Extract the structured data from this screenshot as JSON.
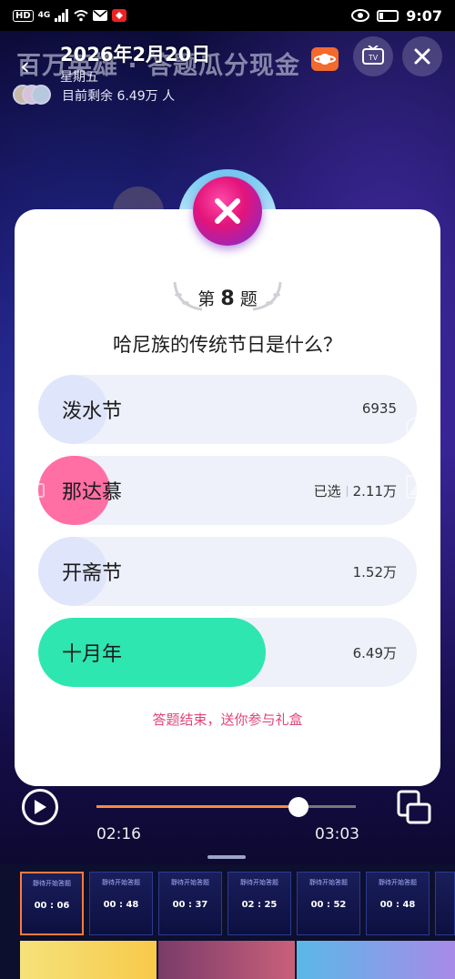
{
  "status_bar": {
    "hd": "HD",
    "signal": "4G",
    "time": "9:07"
  },
  "header": {
    "banner_title": "百万英雄 · 答题瓜分现金",
    "date": "2026年2月20日",
    "weekday": "星期五",
    "remaining": "目前剩余 6.49万 人"
  },
  "quiz": {
    "question_prefix": "第",
    "question_number": "8",
    "question_suffix": "题",
    "question": "哈尼族的传统节日是什么？",
    "options": [
      {
        "label": "泼水节",
        "count": "6935",
        "selected": "",
        "fraction": 0.17,
        "color": "#dfe5fb"
      },
      {
        "label": "那达慕",
        "count": "2.11万",
        "selected": "已选",
        "fraction": 0.19,
        "color": "#ff6fa4"
      },
      {
        "label": "开斋节",
        "count": "1.52万",
        "selected": "",
        "fraction": 0.17,
        "color": "#dfe5fb"
      },
      {
        "label": "十月年",
        "count": "6.49万",
        "selected": "",
        "fraction": 0.6,
        "color": "#2ee6b0"
      }
    ],
    "end_message": "答题结束，送你参与礼盒"
  },
  "player": {
    "current_time": "02:16",
    "total_time": "03:03",
    "progress": 0.78,
    "accent": "#ff8a3c"
  },
  "thumbnails": [
    {
      "title": "靜待开始答题",
      "time": "00 : 06"
    },
    {
      "title": "靜待开始答题",
      "time": "00 : 48"
    },
    {
      "title": "靜待开始答题",
      "time": "00 : 37"
    },
    {
      "title": "靜待开始答题",
      "time": "02 : 25"
    },
    {
      "title": "靜待开始答题",
      "time": "00 : 52"
    },
    {
      "title": "靜待开始答题",
      "time": "00 : 48"
    }
  ]
}
